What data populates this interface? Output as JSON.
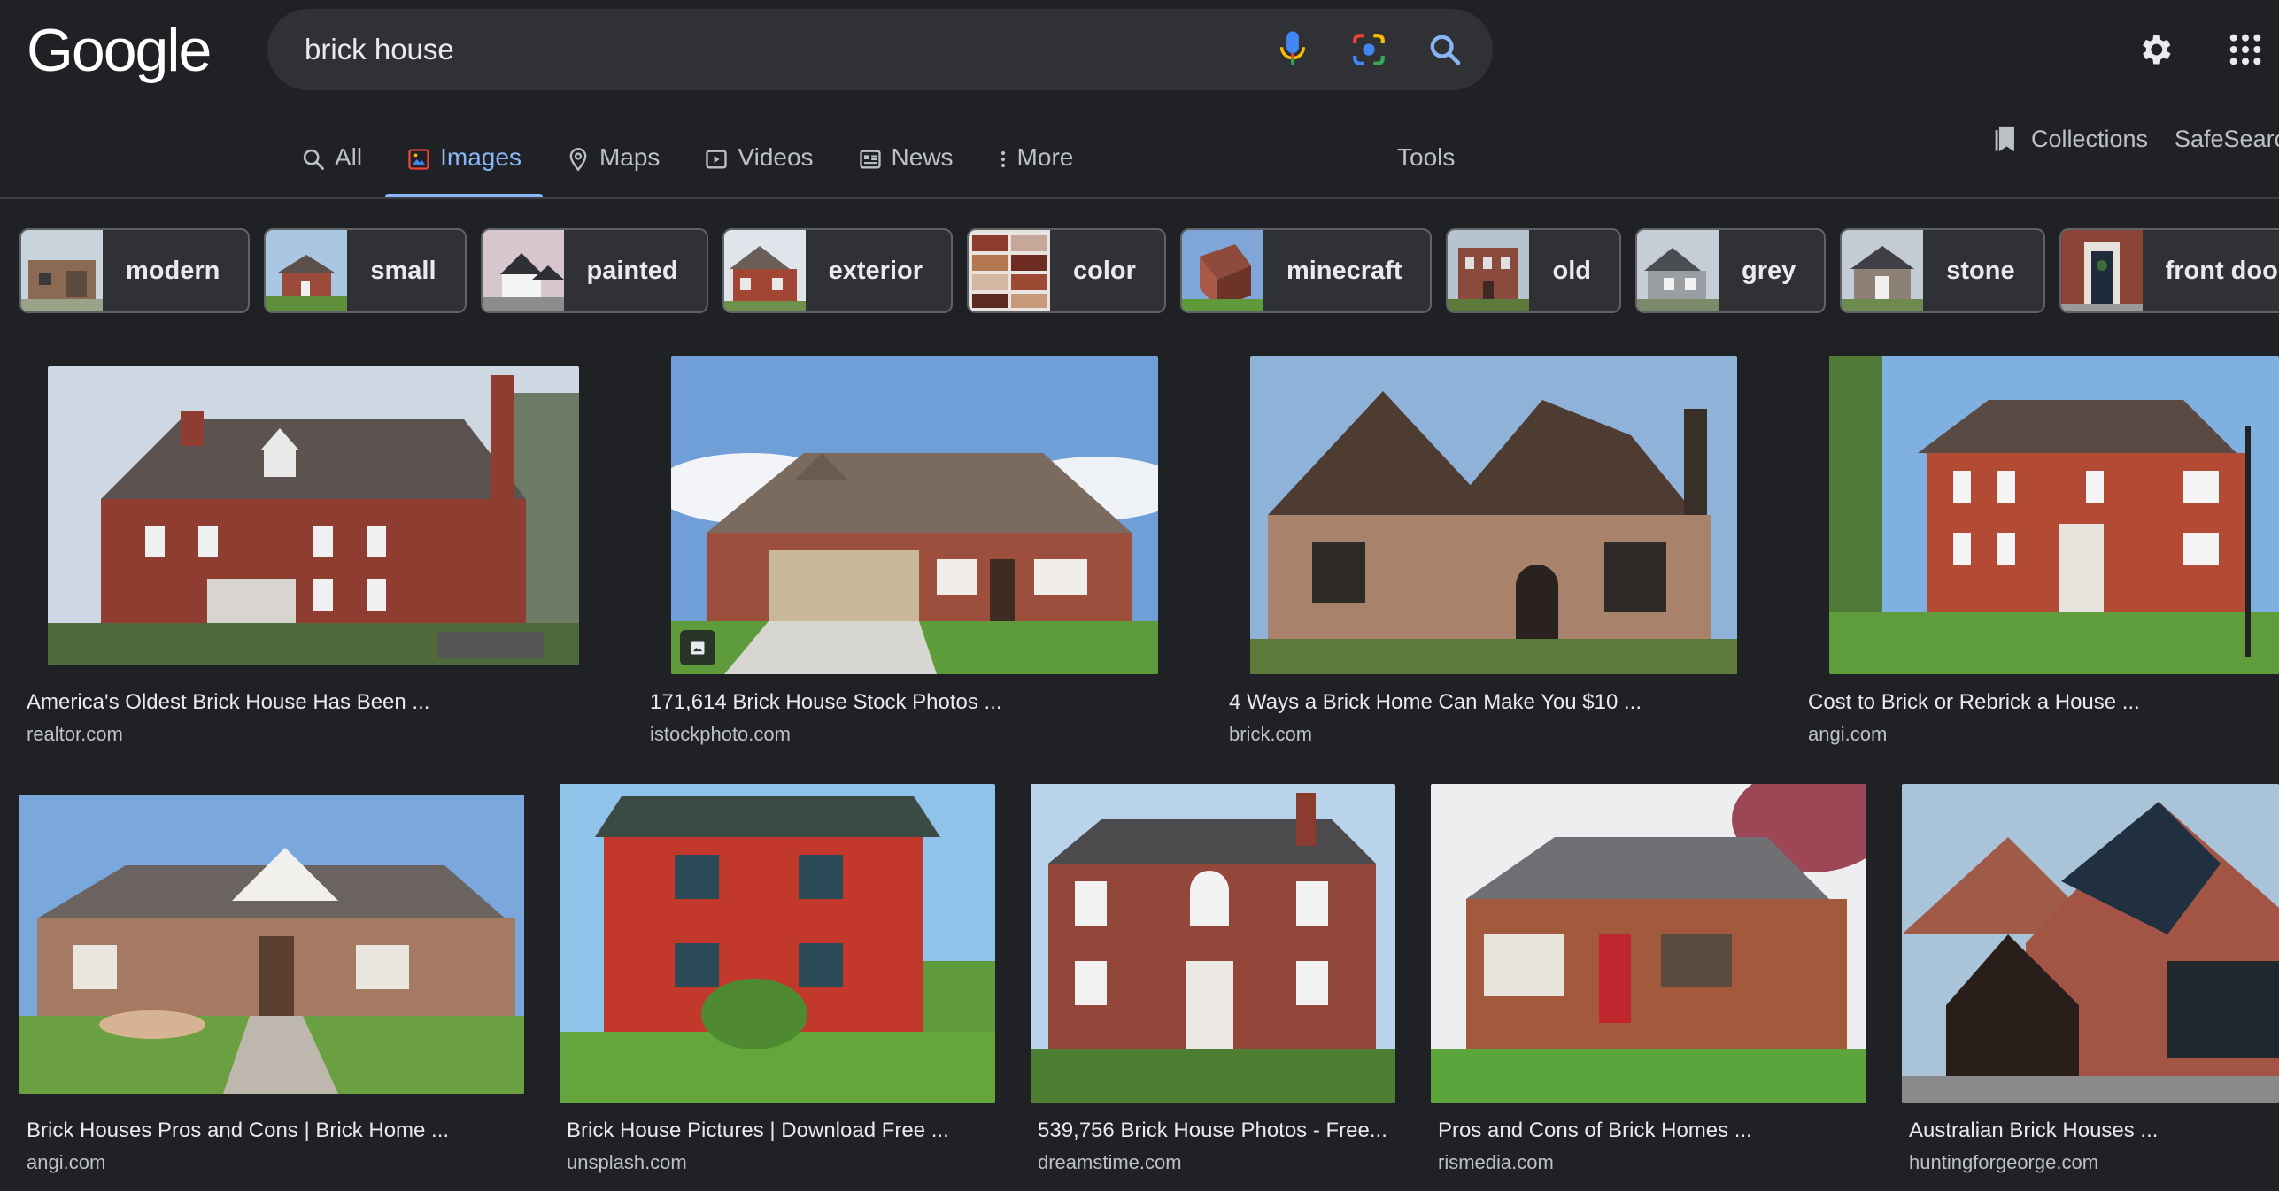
{
  "header": {
    "logo": "Google",
    "search_value": "brick house"
  },
  "nav": {
    "tabs": [
      {
        "label": "All",
        "icon": "search-icon"
      },
      {
        "label": "Images",
        "icon": "image-icon",
        "active": true
      },
      {
        "label": "Maps",
        "icon": "map-pin-icon"
      },
      {
        "label": "Videos",
        "icon": "video-icon"
      },
      {
        "label": "News",
        "icon": "news-icon"
      },
      {
        "label": "More",
        "icon": "more-vertical-icon"
      }
    ],
    "tools": "Tools",
    "collections": "Collections",
    "safesearch": "SafeSearch"
  },
  "chips": [
    {
      "label": "modern"
    },
    {
      "label": "small"
    },
    {
      "label": "painted"
    },
    {
      "label": "exterior"
    },
    {
      "label": "color"
    },
    {
      "label": "minecraft"
    },
    {
      "label": "old"
    },
    {
      "label": "grey"
    },
    {
      "label": "stone"
    },
    {
      "label": "front door"
    }
  ],
  "results": [
    {
      "title": "America's Oldest Brick House Has Been ...",
      "source": "realtor.com"
    },
    {
      "title": "171,614 Brick House Stock Photos ...",
      "source": "istockphoto.com"
    },
    {
      "title": "4 Ways a Brick Home Can Make You $10 ...",
      "source": "brick.com"
    },
    {
      "title": "Cost to Brick or Rebrick a House ...",
      "source": "angi.com"
    },
    {
      "title": "Brick Houses Pros and Cons | Brick Home ...",
      "source": "angi.com"
    },
    {
      "title": "Brick House Pictures | Download Free ...",
      "source": "unsplash.com"
    },
    {
      "title": "539,756 Brick House Photos - Free...",
      "source": "dreamstime.com"
    },
    {
      "title": "Pros and Cons of Brick Homes ...",
      "source": "rismedia.com"
    },
    {
      "title": "Australian Brick Houses ...",
      "source": "huntingforgeorge.com"
    }
  ],
  "colors": {
    "background": "#202124",
    "accent": "#8ab4f8",
    "text": "#e8eaed",
    "muted": "#bdc1c6"
  }
}
